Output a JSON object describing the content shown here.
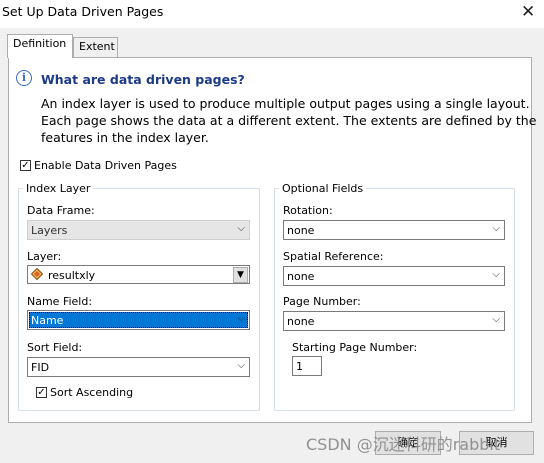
{
  "window": {
    "title": "Set Up Data Driven Pages",
    "close_symbol": "✕"
  },
  "tabs": [
    {
      "label": "Definition",
      "active": true
    },
    {
      "label": "Extent",
      "active": false
    }
  ],
  "info": {
    "icon": "info-icon",
    "heading": "What are data driven pages?",
    "lines": [
      "An index layer is used to produce multiple output pages using a single layout.",
      "Each page shows the data at a different extent.  The extents are defined by the",
      "features in the index layer."
    ]
  },
  "enable_checkbox": {
    "label": "Enable Data Driven Pages",
    "checked": true,
    "mark": "✓"
  },
  "index_layer": {
    "title": "Index Layer",
    "data_frame": {
      "label": "Data Frame:",
      "value": "Layers"
    },
    "layer": {
      "label": "Layer:",
      "value": "resultxly",
      "icon": "polygon-layer-icon"
    },
    "name_field": {
      "label": "Name Field:",
      "value": "Name"
    },
    "sort_field": {
      "label": "Sort Field:",
      "value": "FID"
    },
    "sort_ascending": {
      "label": "Sort Ascending",
      "checked": true,
      "mark": "✓"
    }
  },
  "optional_fields": {
    "title": "Optional Fields",
    "rotation": {
      "label": "Rotation:",
      "value": "none"
    },
    "spatial_reference": {
      "label": "Spatial Reference:",
      "value": "none"
    },
    "page_number": {
      "label": "Page Number:",
      "value": "none"
    },
    "starting_page_number": {
      "label": "Starting Page Number:",
      "value": "1"
    }
  },
  "icons": {
    "dropdown": "⌵",
    "dropdown_button": "▼"
  },
  "footer": {
    "ok_label": "确定",
    "cancel_label": "取消",
    "watermark": "CSDN @沉迷科研的rabbit"
  },
  "colors": {
    "accent": "#0078d7",
    "heading": "#1d3a8a",
    "info_icon": "#3b6ec4"
  }
}
